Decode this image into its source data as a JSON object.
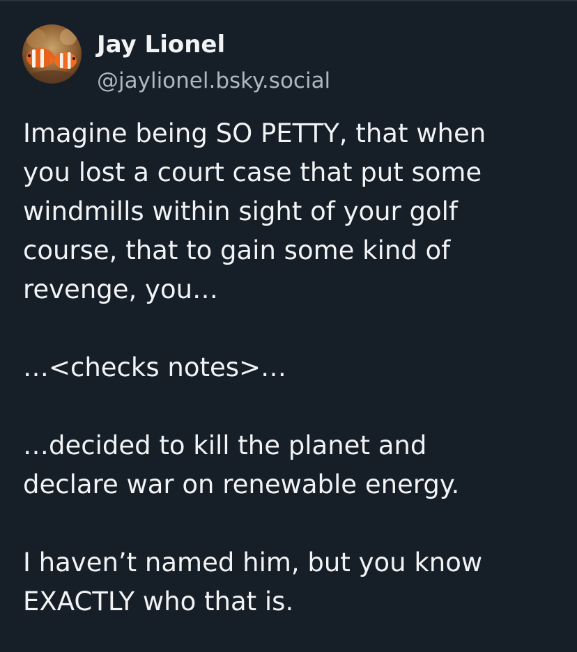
{
  "post": {
    "author": {
      "display_name": "Jay Lionel",
      "handle": "@jaylionel.bsky.social",
      "avatar_icon": "clownfish-avatar-icon"
    },
    "paragraphs": [
      {
        "lines": [
          "Imagine being SO PETTY, that when",
          "you lost a court case that put some",
          "windmills within sight of your golf",
          "course, that to gain some kind of",
          "revenge, you…"
        ]
      },
      {
        "lines": [
          "…<checks notes>…"
        ]
      },
      {
        "lines": [
          "…decided to kill the planet and",
          "declare war on renewable energy."
        ]
      },
      {
        "lines": [
          "I haven’t named him, but you know",
          "EXACTLY who that is."
        ]
      }
    ]
  },
  "colors": {
    "background": "#161e27",
    "text_primary": "#f1f3f5",
    "text_secondary": "#aeb8c2"
  }
}
